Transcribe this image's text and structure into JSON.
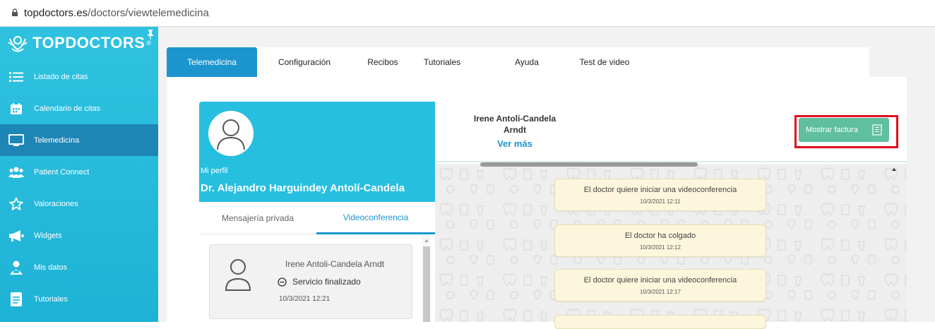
{
  "browser": {
    "url_domain": "topdoctors.es",
    "url_path": "/doctors/viewtelemedicina"
  },
  "sidebar": {
    "logo_text": "TOPDOCTORS",
    "logo_mark": "®",
    "items": [
      {
        "label": "Listado de citas",
        "icon": "list-icon"
      },
      {
        "label": "Calendario de citas",
        "icon": "calendar-icon"
      },
      {
        "label": "Telemedicina",
        "icon": "monitor-icon",
        "active": true
      },
      {
        "label": "Patient Connect",
        "icon": "users-icon"
      },
      {
        "label": "Valoraciones",
        "icon": "star-icon"
      },
      {
        "label": "Widgets",
        "icon": "megaphone-icon"
      },
      {
        "label": "Mis datos",
        "icon": "user-icon"
      },
      {
        "label": "Tutoriales",
        "icon": "document-icon"
      }
    ]
  },
  "tabs": [
    {
      "label": "Telemedicina",
      "active": true
    },
    {
      "label": "Configuración"
    },
    {
      "label": "Recibos"
    },
    {
      "label": "Tutoriales"
    },
    {
      "label": "Ayuda"
    },
    {
      "label": "Test de video"
    }
  ],
  "profile": {
    "section_label": "Mi perfil",
    "doctor_name": "Dr. Alejandro Harguindey Antolí-Candela"
  },
  "subtabs": {
    "private": "Mensajería privada",
    "video": "Videoconferencia"
  },
  "conversation": {
    "patient_name": "Irene Antoli-Candela Arndt",
    "status": "Servicio finalizado",
    "date": "10/3/2021 12:21"
  },
  "chat": {
    "patient_line1": "Irene Antoli-Candela",
    "patient_line2": "Arndt",
    "ver_mas": "Ver más",
    "factura_button": "Mostrar factura",
    "messages": [
      {
        "text": "El doctor quiere iniciar una videoconferencia",
        "time": "10/3/2021 12:11"
      },
      {
        "text": "El doctor ha colgado",
        "time": "10/3/2021 12:12"
      },
      {
        "text": "El doctor quiere iniciar una videoconferencia",
        "time": "10/3/2021 12:17"
      }
    ]
  },
  "colors": {
    "sidebar": "#27bfe0",
    "active_nav": "#1d86b6",
    "accent_blue": "#1c95cf",
    "factura_green": "#5fbf9f",
    "highlight_red": "#e01020",
    "bubble": "#fbf6dc"
  }
}
